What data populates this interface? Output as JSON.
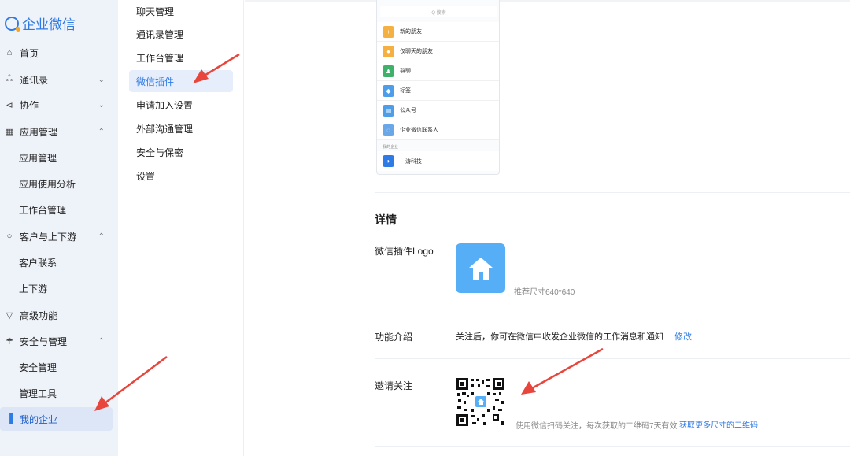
{
  "brand": {
    "name": "企业微信"
  },
  "leftnav": {
    "items": [
      {
        "label": "首页",
        "icon": "home-icon",
        "chevron": ""
      },
      {
        "label": "通讯录",
        "icon": "org-tree-icon",
        "chevron": "⌄"
      },
      {
        "label": "协作",
        "icon": "share-icon",
        "chevron": "⌄"
      },
      {
        "label": "应用管理",
        "icon": "grid-icon",
        "chevron": "⌃"
      },
      {
        "label": "客户与上下游",
        "icon": "chat-bubble-icon",
        "chevron": "⌃"
      },
      {
        "label": "高级功能",
        "icon": "diamond-icon",
        "chevron": ""
      },
      {
        "label": "安全与管理",
        "icon": "umbrella-icon",
        "chevron": "⌃"
      },
      {
        "label": "我的企业",
        "icon": "building-icon",
        "chevron": ""
      }
    ],
    "sub_app": [
      "应用管理",
      "应用使用分析",
      "工作台管理"
    ],
    "sub_customer": [
      "客户联系",
      "上下游"
    ],
    "sub_security": [
      "安全管理",
      "管理工具"
    ]
  },
  "submenu": {
    "items": [
      "聊天管理",
      "通讯录管理",
      "工作台管理",
      "微信插件",
      "申请加入设置",
      "外部沟通管理",
      "安全与保密",
      "设置"
    ],
    "active": "微信插件"
  },
  "preview": {
    "search_placeholder": "Q 搜索",
    "rows": [
      {
        "label": "新的朋友",
        "color": "#f5b042"
      },
      {
        "label": "仅聊天的朋友",
        "color": "#f5b042"
      },
      {
        "label": "群聊",
        "color": "#3fb16a"
      },
      {
        "label": "标签",
        "color": "#4d9de8"
      },
      {
        "label": "公众号",
        "color": "#4d9de8"
      },
      {
        "label": "企业微信联系人",
        "color": "#6aa7e8"
      }
    ],
    "section_label": "我的企业",
    "company": {
      "label": "一涛科技",
      "color": "#2f7be5"
    }
  },
  "details": {
    "title": "详情",
    "logo_label": "微信插件Logo",
    "logo_hint": "推荐尺寸640*640",
    "intro_label": "功能介绍",
    "intro_text": "关注后，你可在微信中收发企业微信的工作消息和通知",
    "intro_action": "修改",
    "invite_label": "邀请关注",
    "invite_hint": "使用微信扫码关注，每次获取的二维码7天有效",
    "invite_action": "获取更多尺寸的二维码"
  },
  "colors": {
    "accent": "#2f7be5",
    "arrow": "#e8453c",
    "logo_bg": "#55aef6"
  }
}
